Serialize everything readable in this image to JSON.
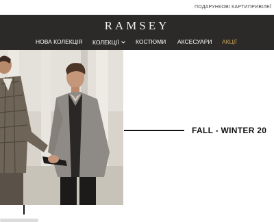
{
  "topbar": {
    "gift_cards": "ПОДАРУНКОВІ КАРТИ",
    "privileges": "ПРИВІЛЕЇ"
  },
  "header": {
    "logo": "RAMSEY",
    "background": "#2b2a28"
  },
  "nav": {
    "items": [
      {
        "label": "НОВА КОЛЕКЦІЯ"
      },
      {
        "label": "КОЛЕКЦІЇ",
        "icon": "chevron-down-icon"
      },
      {
        "label": "КОСТЮМИ"
      },
      {
        "label": "АКСЕСУАРИ"
      },
      {
        "label": "АКЦІЇ",
        "color": "#c9a25a"
      }
    ]
  },
  "hero": {
    "headline": "FALL - WINTER 20"
  }
}
